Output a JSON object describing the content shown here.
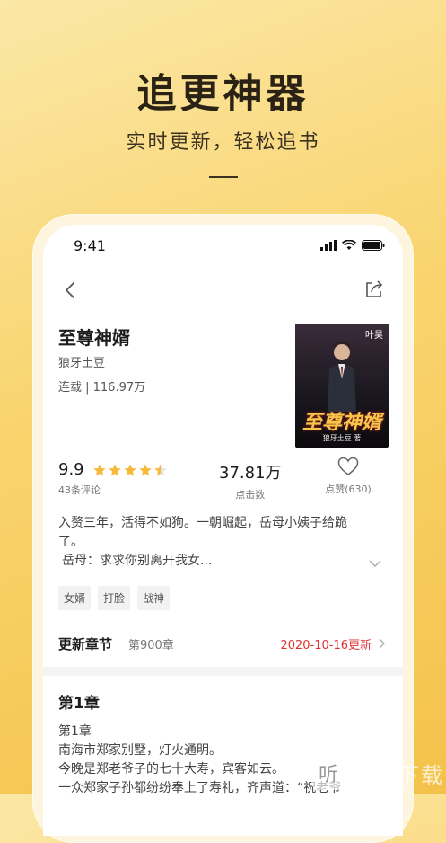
{
  "promo": {
    "headline": "追更神器",
    "subline": "实时更新，轻松追书"
  },
  "status_bar": {
    "time": "9:41"
  },
  "book": {
    "title": "至尊神婿",
    "author": "狼牙土豆",
    "meta": "连载 | 116.97万",
    "cover": {
      "tag": "叶昊",
      "title": "至尊神婿",
      "author": "狼牙土豆 著"
    }
  },
  "stats": {
    "rating": "9.9",
    "rating_stars": 4.5,
    "reviews": "43条评论",
    "clicks": "37.81万",
    "clicks_label": "点击数",
    "likes_label": "点赞(630)"
  },
  "description": {
    "line1": "入赘三年，活得不如狗。一朝崛起，岳母小姨子给跪了。",
    "line2": "岳母：求求你别离开我女..."
  },
  "tags": [
    "女婿",
    "打脸",
    "战神"
  ],
  "update": {
    "label": "更新章节",
    "chapter": "第900章",
    "date": "2020-10-16更新"
  },
  "chapter_preview": {
    "title": "第1章",
    "lines": [
      "第1章",
      "南海市郑家别墅，灯火通明。",
      "今晚是郑老爷子的七十大寿，宾客如云。",
      "一众郑家子孙都纷纷奉上了寿礼，齐声道：“祝老爷"
    ]
  },
  "watermark": {
    "logo_char": "听",
    "text": "一听下载"
  },
  "colors": {
    "background": "#f9d46e",
    "accent_red": "#e03030",
    "star": "#f6b93b"
  }
}
